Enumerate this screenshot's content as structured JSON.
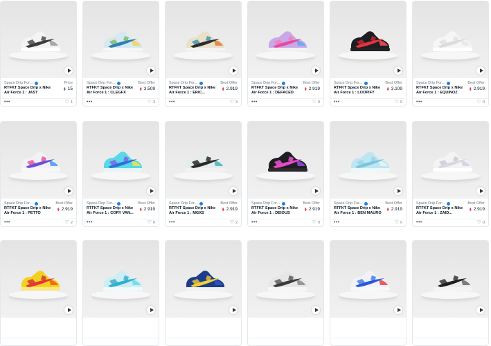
{
  "colors": {
    "eth_gray": "#607d8b",
    "eth_red": "#e8424f",
    "verified_blue": "#2081e2",
    "text_dark": "#04111d",
    "text_muted": "#707a83"
  },
  "icons": {
    "play": "play-icon",
    "verified": "verified-badge-icon",
    "eth": "ethereum-icon",
    "more": "more-icon",
    "like": "heart-icon"
  },
  "cards": [
    {
      "collection": "Space Drip For...",
      "title": "RTFKT Space Drip x Nike Air Force 1 : JAST",
      "price_label": "Price",
      "price": "15",
      "eth_color": "#607d8b",
      "likes": "1",
      "shoe": {
        "upper": "#f4f4f4",
        "swoosh": "#3c3c3c",
        "accent": "#9a9a9a",
        "sole": "#ffffff",
        "pattern": "#444444"
      }
    },
    {
      "collection": "Space Drip For...",
      "title": "RTFKT Space Drip x Nike Air Force 1 : CLEGFX",
      "price_label": "Best Offer",
      "price": "3.509",
      "eth_color": "#e8424f",
      "likes": "3",
      "shoe": {
        "upper": "#d6e8f0",
        "swoosh": "#2c7fb8",
        "accent": "#f3d44a",
        "sole": "#f6f6f6",
        "pattern": "#7bb661"
      }
    },
    {
      "collection": "Space Drip For...",
      "title": "RTFKT Space Drip x Nike Air Force 1 : ERIC...",
      "price_label": "Best Offer",
      "price": "2.919",
      "eth_color": "#e8424f",
      "likes": "3",
      "shoe": {
        "upper": "#e8e0c8",
        "swoosh": "#2b2b2b",
        "accent": "#e07b3a",
        "sole": "#f3f3f3",
        "pattern": "#3d8fb0"
      }
    },
    {
      "collection": "Space Drip For...",
      "title": "RTFKT Space Drip x Nike Air Force 1 : DEFACED",
      "price_label": "Best Offer",
      "price": "2.919",
      "eth_color": "#e8424f",
      "likes": "0",
      "shoe": {
        "upper": "#c9a8e8",
        "swoosh": "#e84aa0",
        "accent": "#5fa8f0",
        "sole": "#f1f1f1",
        "pattern": "#f27bb8"
      }
    },
    {
      "collection": "Space Drip For...",
      "title": "RTFKT Space Drip x Nike Air Force 1 : LOOPIFY",
      "price_label": "Best Offer",
      "price": "3.109",
      "eth_color": "#e8424f",
      "likes": "0",
      "shoe": {
        "upper": "#1d1d22",
        "swoosh": "#e8323c",
        "accent": "#ff4f5e",
        "sole": "#222226",
        "pattern": "#c22a3a"
      }
    },
    {
      "collection": "Space Drip For...",
      "title": "RTFKT Space Drip x Nike Air Force 1 : EQUINOZ",
      "price_label": "Best Offer",
      "price": "2.919",
      "eth_color": "#e8424f",
      "likes": "0",
      "shoe": {
        "upper": "#f6f6f6",
        "swoosh": "#dcdcdc",
        "accent": "#e6e6e6",
        "sole": "#ffffff",
        "pattern": "#e0e0e0"
      }
    },
    {
      "collection": "Space Drip For...",
      "title": "RTFKT Space Drip x Nike Air Force 1 : PETTO",
      "price_label": "Best Offer",
      "price": "2.919",
      "eth_color": "#e8424f",
      "likes": "2",
      "shoe": {
        "upper": "#f2f2f6",
        "swoosh": "#6a4fd8",
        "accent": "#4a9af0",
        "sole": "#f7f7f7",
        "pattern": "#e64a9a"
      }
    },
    {
      "collection": "Space Drip For...",
      "title": "RTFKT Space Drip x Nike Air Force 1 : CORY VAN...",
      "price_label": "Best Offer",
      "price": "2.919",
      "eth_color": "#e8424f",
      "likes": "0",
      "shoe": {
        "upper": "#58d8e8",
        "swoosh": "#2f6fd8",
        "accent": "#f0e64a",
        "sole": "#e8f6f8",
        "pattern": "#8a5ae0"
      }
    },
    {
      "collection": "Space Drip For...",
      "title": "RTFKT Space Drip x Nike Air Force 1 : MGXS",
      "price_label": "Best Offer",
      "price": "2.919",
      "eth_color": "#e8424f",
      "likes": "2",
      "shoe": {
        "upper": "#e4ecec",
        "swoosh": "#2a2a2a",
        "accent": "#4fb0b8",
        "sole": "#f2f2f2",
        "pattern": "#1e1e1e"
      }
    },
    {
      "collection": "Space Drip For...",
      "title": "RTFKT Space Drip x Nike Air Force 1 : DEIOUS",
      "price_label": "Best Offer",
      "price": "2.919",
      "eth_color": "#e8424f",
      "likes": "0",
      "shoe": {
        "upper": "#1e1e22",
        "swoosh": "#e84ac8",
        "accent": "#9a4ae8",
        "sole": "#2a2a2e",
        "pattern": "#f25ad8"
      }
    },
    {
      "collection": "Space Drip For...",
      "title": "RTFKT Space Drip x Nike Air Force 1 : BEN MAURO",
      "price_label": "Best Offer",
      "price": "2.919",
      "eth_color": "#e8424f",
      "likes": "0",
      "shoe": {
        "upper": "#bfe6f0",
        "swoosh": "#7ac6de",
        "accent": "#e6f4f8",
        "sole": "#eef8fa",
        "pattern": "#9ad4e6"
      }
    },
    {
      "collection": "Space Drip For...",
      "title": "RTFKT Space Drip x Nike Air Force 1 : ZAID...",
      "price_label": "Best Offer",
      "price": "2.919",
      "eth_color": "#e8424f",
      "likes": "0",
      "shoe": {
        "upper": "#f4f4f4",
        "swoosh": "#d8d8e0",
        "accent": "#cfcfe8",
        "sole": "#ffffff",
        "pattern": "#c8c8d8"
      }
    },
    {
      "collection": "",
      "title": "",
      "price_label": "",
      "price": "",
      "eth_color": "#e8424f",
      "likes": "",
      "shoe": {
        "upper": "#f2d21e",
        "swoosh": "#e8323c",
        "accent": "#f25a1e",
        "sole": "#f8e88a",
        "pattern": "#d82a2a"
      }
    },
    {
      "collection": "",
      "title": "",
      "price_label": "",
      "price": "",
      "eth_color": "#e8424f",
      "likes": "",
      "shoe": {
        "upper": "#cdeef4",
        "swoosh": "#2fb0d0",
        "accent": "#6ad8e8",
        "sole": "#f0fafc",
        "pattern": "#38a8c8"
      }
    },
    {
      "collection": "",
      "title": "",
      "price_label": "",
      "price": "",
      "eth_color": "#e8424f",
      "likes": "",
      "shoe": {
        "upper": "#1e3c8a",
        "swoosh": "#f0d23a",
        "accent": "#2a58b8",
        "sole": "#f2f2f2",
        "pattern": "#f2c83a"
      }
    },
    {
      "collection": "",
      "title": "",
      "price_label": "",
      "price": "",
      "eth_color": "#e8424f",
      "likes": "",
      "shoe": {
        "upper": "#e6e6e6",
        "swoosh": "#3a3a3a",
        "accent": "#8a8a8a",
        "sole": "#f6f6f6",
        "pattern": "#555555"
      }
    },
    {
      "collection": "",
      "title": "",
      "price_label": "",
      "price": "",
      "eth_color": "#e8424f",
      "likes": "",
      "shoe": {
        "upper": "#f2f2f6",
        "swoosh": "#2a58d8",
        "accent": "#e8424f",
        "sole": "#f8f8f8",
        "pattern": "#3a7ae8"
      }
    },
    {
      "collection": "",
      "title": "",
      "price_label": "",
      "price": "",
      "eth_color": "#e8424f",
      "likes": "",
      "shoe": {
        "upper": "#ececec",
        "swoosh": "#1e1e1e",
        "accent": "#6a6a6a",
        "sole": "#f4f4f4",
        "pattern": "#2a2a2a"
      }
    }
  ]
}
